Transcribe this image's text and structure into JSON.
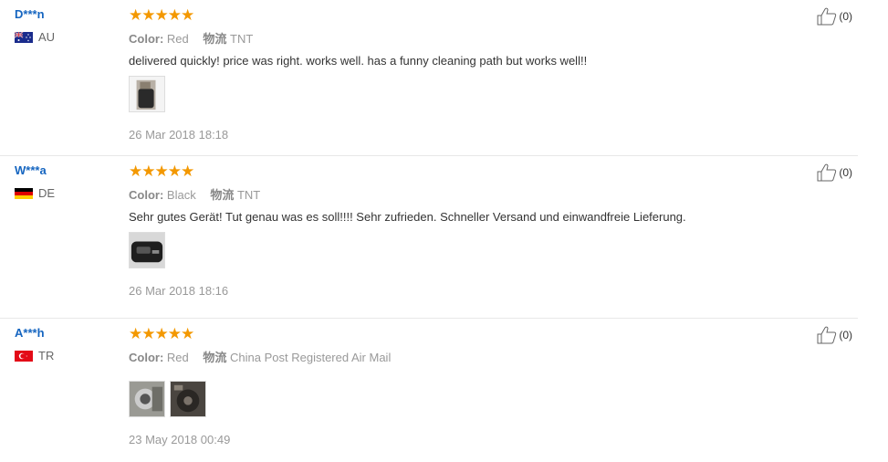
{
  "reviews": [
    {
      "user": "D***n",
      "country": "AU",
      "rating": 5,
      "stars": "★★★★★",
      "color_label": "Color:",
      "color": "Red",
      "shipping_label": "物流",
      "shipping": "TNT",
      "text": "delivered quickly! price was right. works well. has a funny cleaning path but works well!!",
      "photos": [
        "photo-1"
      ],
      "date": "26 Mar 2018 18:18",
      "helpful": "(0)"
    },
    {
      "user": "W***a",
      "country": "DE",
      "rating": 5,
      "stars": "★★★★★",
      "color_label": "Color:",
      "color": "Black",
      "shipping_label": "物流",
      "shipping": "TNT",
      "text": "Sehr gutes Gerät! Tut genau was es soll!!!! Sehr zufrieden. Schneller Versand und einwandfreie Lieferung.",
      "photos": [
        "photo-1"
      ],
      "date": "26 Mar 2018 18:16",
      "helpful": "(0)"
    },
    {
      "user": "A***h",
      "country": "TR",
      "rating": 5,
      "stars": "★★★★★",
      "color_label": "Color:",
      "color": "Red",
      "shipping_label": "物流",
      "shipping": "China Post Registered Air Mail",
      "text": "",
      "photos": [
        "photo-1",
        "photo-2"
      ],
      "date": "23 May 2018 00:49",
      "helpful": "(0)"
    }
  ],
  "colors": {
    "username": "#1565c0",
    "star": "#f39800",
    "meta": "#999999"
  }
}
